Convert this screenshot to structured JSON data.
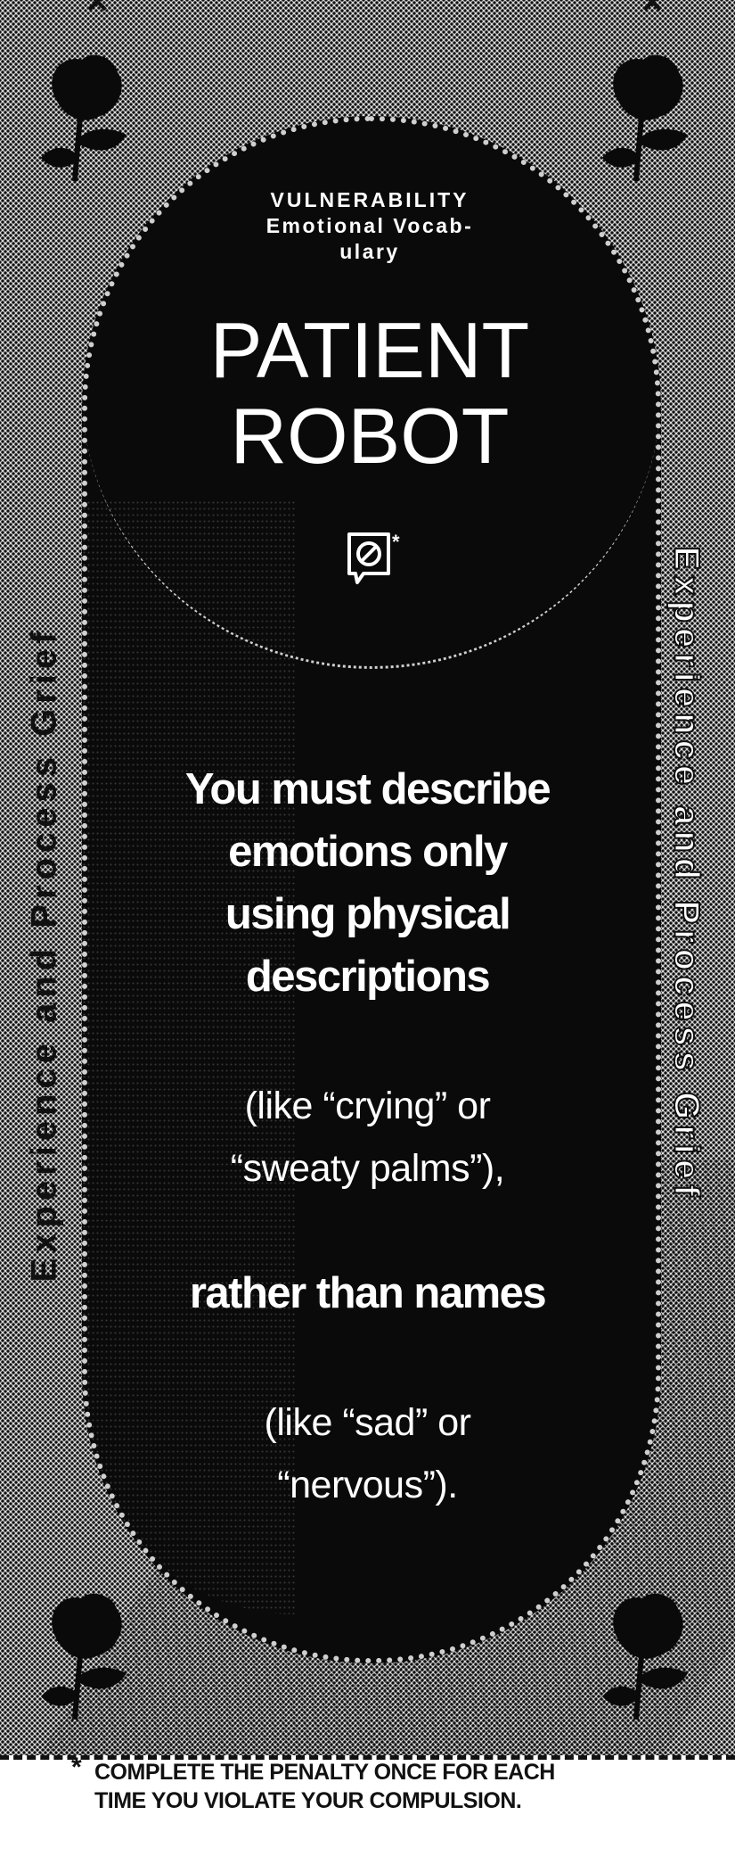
{
  "card": {
    "category": {
      "line1": "VULNERABILITY",
      "line2": "Emotional Vocab-",
      "line3": "ulary"
    },
    "title": {
      "line1": "PATIENT",
      "line2": "ROBOT"
    },
    "badge_icon": "no-symbol-speech-bubble-icon",
    "badge_mark": "*",
    "rule": {
      "main_line1": "You must describe",
      "main_line2": "emotions only",
      "main_line3": "using physical",
      "main_line4": "descriptions",
      "example1_line1": "(like “crying” or",
      "example1_line2": "“sweaty palms”),",
      "contrast": "rather than names",
      "example2_line1": "(like “sad” or",
      "example2_line2": "“nervous”)."
    },
    "side_label_left": "Experience and Process Grief",
    "side_label_right": "Experience and Process Grief",
    "footnote": {
      "mark": "*",
      "line1": "COMPLETE THE PENALTY ONCE FOR EACH",
      "line2": "TIME YOU VIOLATE YOUR COMPULSION."
    },
    "corner_icon": "rose-icon",
    "cut_mark_icon": "x-mark-icon",
    "colors": {
      "ink": "#0a0a0a",
      "paper": "#ffffff",
      "halftone": "#d9d9d9"
    }
  }
}
